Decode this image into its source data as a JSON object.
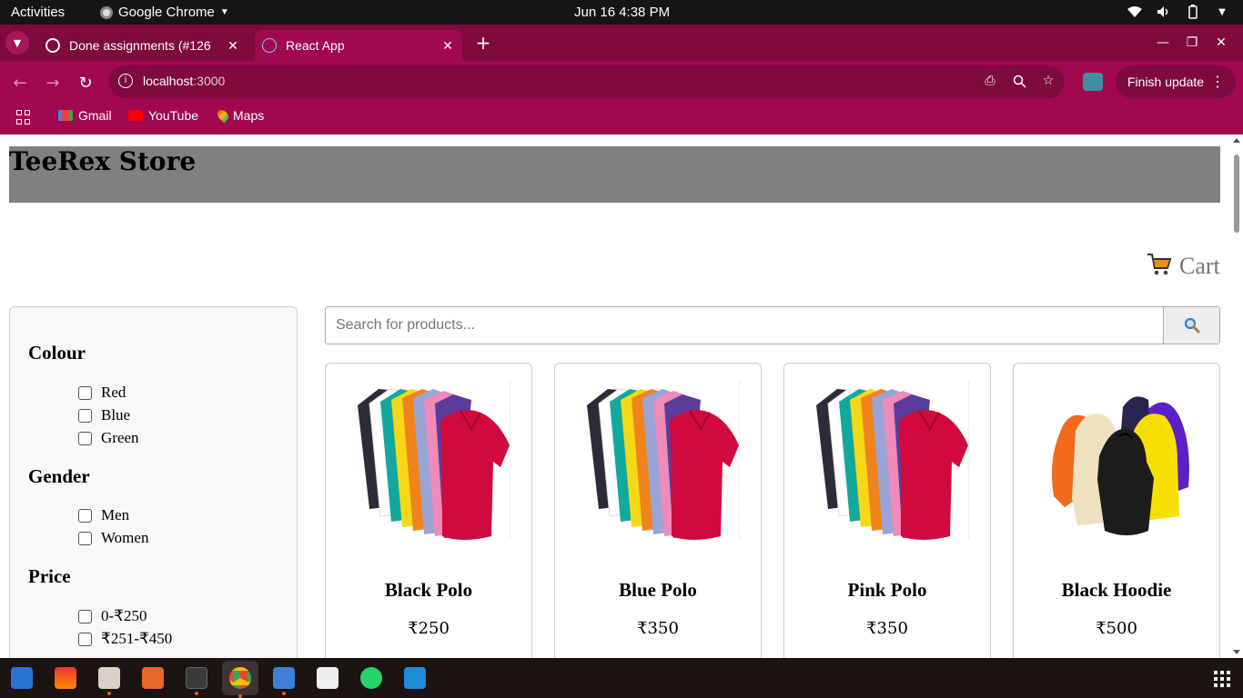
{
  "system": {
    "activities": "Activities",
    "app_name": "Google Chrome",
    "clock": "Jun 16  4:38 PM"
  },
  "browser": {
    "tabs": [
      {
        "label": "Done assignments (#126",
        "favicon": "github-icon"
      },
      {
        "label": "React App",
        "favicon": "react-icon"
      }
    ],
    "url": "localhost",
    "url_port": ":3000",
    "finish_update": "Finish update",
    "bookmarks": [
      {
        "label": "Gmail",
        "icon": "gmail-icon"
      },
      {
        "label": "YouTube",
        "icon": "youtube-icon"
      },
      {
        "label": "Maps",
        "icon": "maps-icon"
      }
    ],
    "colors": {
      "frame": "#a1084f",
      "tabstrip": "#7e0a3e"
    }
  },
  "store": {
    "title": "TeeRex Store",
    "cart_label": "Cart",
    "search_placeholder": "Search for products...",
    "filters": {
      "colour_heading": "Colour",
      "colour_options": [
        "Red",
        "Blue",
        "Green"
      ],
      "gender_heading": "Gender",
      "gender_options": [
        "Men",
        "Women"
      ],
      "price_heading": "Price",
      "price_options": [
        "0-₹250",
        "₹251-₹450"
      ]
    },
    "products": [
      {
        "name": "Black Polo",
        "price": "₹250",
        "image": "polo-shirts-image"
      },
      {
        "name": "Blue Polo",
        "price": "₹350",
        "image": "polo-shirts-image"
      },
      {
        "name": "Pink Polo",
        "price": "₹350",
        "image": "polo-shirts-image"
      },
      {
        "name": "Black Hoodie",
        "price": "₹500",
        "image": "hoodies-image"
      }
    ]
  }
}
